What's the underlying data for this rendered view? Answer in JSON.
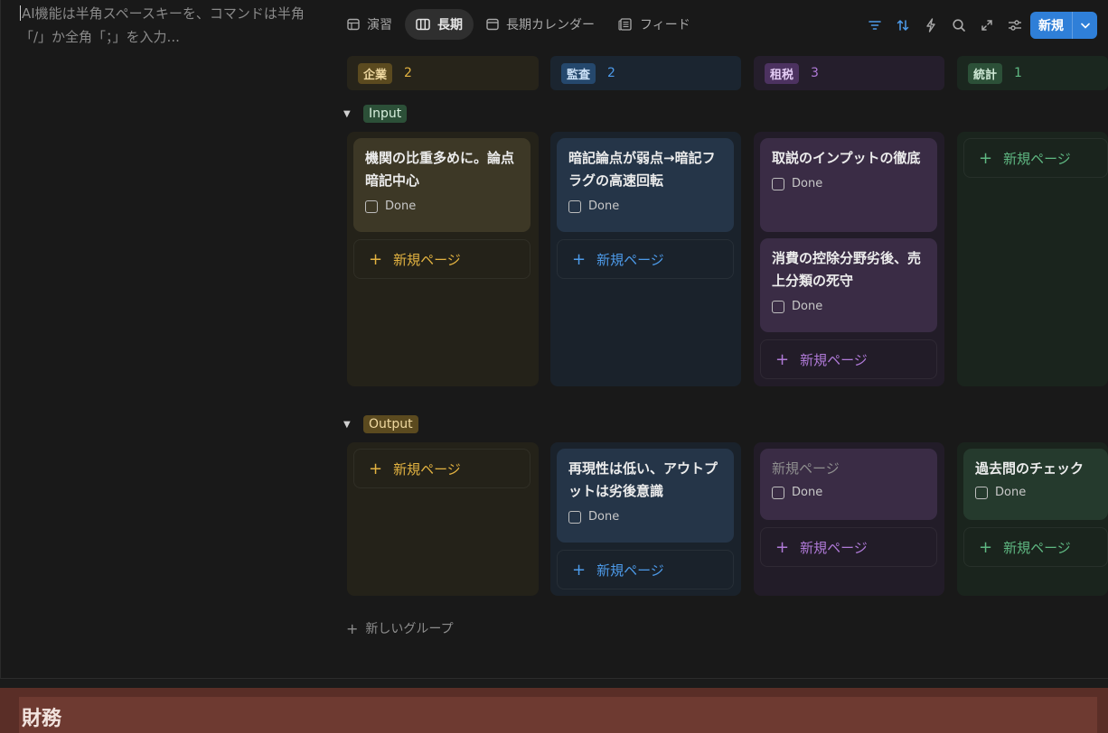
{
  "ai_hint": "AI機能は半角スペースキーを、コマンドは半角「/」か全角「；」を入力...",
  "tabs": [
    {
      "label": "演習",
      "icon": "table-icon"
    },
    {
      "label": "長期",
      "icon": "board-icon",
      "active": true
    },
    {
      "label": "長期カレンダー",
      "icon": "calendar-icon"
    },
    {
      "label": "フィード",
      "icon": "feed-icon"
    }
  ],
  "toolbar": {
    "new_label": "新規",
    "icons": [
      "filter-icon",
      "sort-icon",
      "automation-icon",
      "search-icon",
      "expand-icon",
      "settings-icon"
    ]
  },
  "columns": [
    {
      "name": "企業",
      "count": "2",
      "color": "#e3b341"
    },
    {
      "name": "監査",
      "count": "2",
      "color": "#4d9bea"
    },
    {
      "name": "租税",
      "count": "3",
      "color": "#b07ad8"
    },
    {
      "name": "統計",
      "count": "1",
      "color": "#5fb882"
    }
  ],
  "groups": {
    "input": {
      "label": "Input",
      "cards": {
        "c1": "機関の比重多めに。論点暗記中心",
        "c2": "暗記論点が弱点→暗記フラグの高速回転",
        "c3a": "取説のインプットの徹底",
        "c3b": "消費の控除分野劣後、売上分類の死守"
      }
    },
    "output": {
      "label": "Output",
      "cards": {
        "c2": "再現性は低い、アウトプットは劣後意識",
        "c3": "新規ページ",
        "c4": "過去問のチェック"
      }
    }
  },
  "done_label": "Done",
  "new_page_label": "新規ページ",
  "new_group_label": "新しいグループ",
  "section_title": "財務"
}
